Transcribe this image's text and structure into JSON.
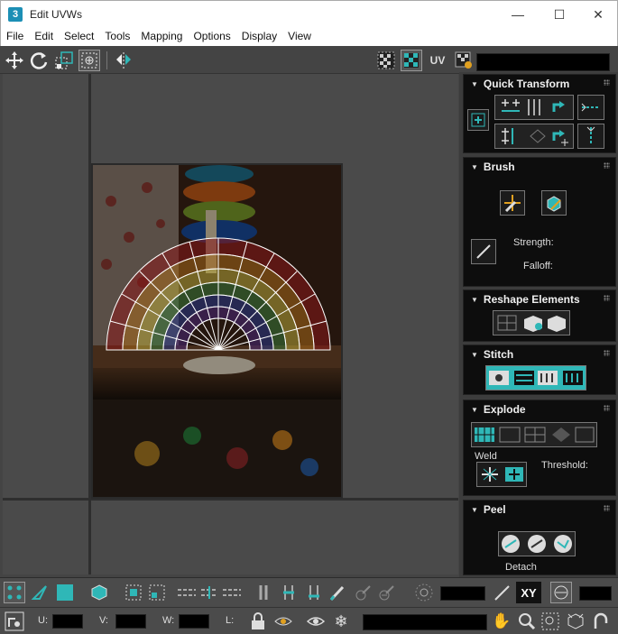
{
  "window": {
    "title": "Edit UVWs",
    "app_icon": "3",
    "min_glyph": "—",
    "max_glyph": "☐",
    "close_glyph": "✕"
  },
  "menu": [
    "File",
    "Edit",
    "Select",
    "Tools",
    "Mapping",
    "Options",
    "Display",
    "View"
  ],
  "toolbar": {
    "uv_label": "UV"
  },
  "rollouts": {
    "quick_transform": {
      "title": "Quick Transform"
    },
    "brush": {
      "title": "Brush",
      "strength_label": "Strength:",
      "falloff_label": "Falloff:"
    },
    "reshape": {
      "title": "Reshape Elements"
    },
    "stitch": {
      "title": "Stitch"
    },
    "explode": {
      "title": "Explode",
      "weld_label": "Weld",
      "threshold_label": "Threshold:"
    },
    "peel": {
      "title": "Peel",
      "detach_label": "Detach"
    }
  },
  "bottom": {
    "xy_label": "XY",
    "u_label": "U:",
    "v_label": "V:",
    "w_label": "W:",
    "l_label": "L:"
  },
  "colors": {
    "accent": "#2fb7b7",
    "panel_bg": "#0d0d0d",
    "viewport_bg": "#4a4a4a"
  }
}
